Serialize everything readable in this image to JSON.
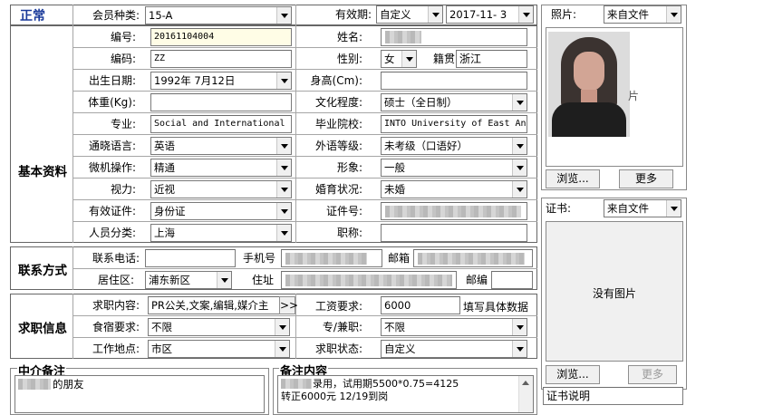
{
  "header": {
    "status": "正常",
    "member_type_label": "会员种类:",
    "member_type_value": "15-A",
    "validity_label": "有效期:",
    "validity_value": "自定义",
    "validity_date": "2017-11- 3"
  },
  "basic": {
    "section_label": "基本资料",
    "number_label": "编号:",
    "number_value": "20161104004",
    "name_label": "姓名:",
    "code_label": "编码:",
    "code_value": "ZZ",
    "gender_label": "性别:",
    "gender_value": "女",
    "native_label": "籍贯",
    "native_value": "浙江",
    "birth_label": "出生日期:",
    "birth_value": "1992年 7月12日",
    "height_label": "身高(Cm):",
    "weight_label": "体重(Kg):",
    "education_label": "文化程度:",
    "education_value": "硕士（全日制）",
    "major_label": "专业:",
    "major_value": "Social and International S",
    "school_label": "毕业院校:",
    "school_value": "INTO University of East An",
    "language_label": "通晓语言:",
    "language_value": "英语",
    "foreign_level_label": "外语等级:",
    "foreign_level_value": "未考级（口语好）",
    "computer_label": "微机操作:",
    "computer_value": "精通",
    "image_label": "形象:",
    "image_value": "一般",
    "eyesight_label": "视力:",
    "eyesight_value": "近视",
    "marital_label": "婚育状况:",
    "marital_value": "未婚",
    "id_type_label": "有效证件:",
    "id_type_value": "身份证",
    "id_number_label": "证件号:",
    "category_label": "人员分类:",
    "category_value": "上海",
    "title_label": "职称:"
  },
  "contact": {
    "section_label": "联系方式",
    "phone_label": "联系电话:",
    "mobile_label": "手机号",
    "email_label": "邮箱",
    "district_label": "居住区:",
    "district_value": "浦东新区",
    "address_label": "住址",
    "zip_label": "邮编"
  },
  "job": {
    "section_label": "求职信息",
    "content_label": "求职内容:",
    "content_value": "PR公关,文案,编辑,媒介主",
    "expand_label": ">>",
    "salary_label": "工资要求:",
    "salary_value": "6000",
    "salary_hint": "填写具体数据",
    "board_label": "食宿要求:",
    "board_value": "不限",
    "parttime_label": "专/兼职:",
    "parttime_value": "不限",
    "location_label": "工作地点:",
    "location_value": "市区",
    "job_status_label": "求职状态:",
    "job_status_value": "自定义"
  },
  "notes": {
    "agency_label": "中介备注",
    "agency_text": "的朋友",
    "remark_label": "备注内容",
    "remark_line1": "录用，试用期5500*0.75=4125",
    "remark_line2": "转正6000元 12/19到岗"
  },
  "photo": {
    "label": "照片:",
    "source_value": "来自文件",
    "browse_label": "浏览...",
    "more_label": "更多"
  },
  "certificate": {
    "label": "证书:",
    "source_value": "来自文件",
    "no_image_text": "没有图片",
    "browse_label": "浏览...",
    "more_label": "更多",
    "desc_value": "证书说明"
  }
}
